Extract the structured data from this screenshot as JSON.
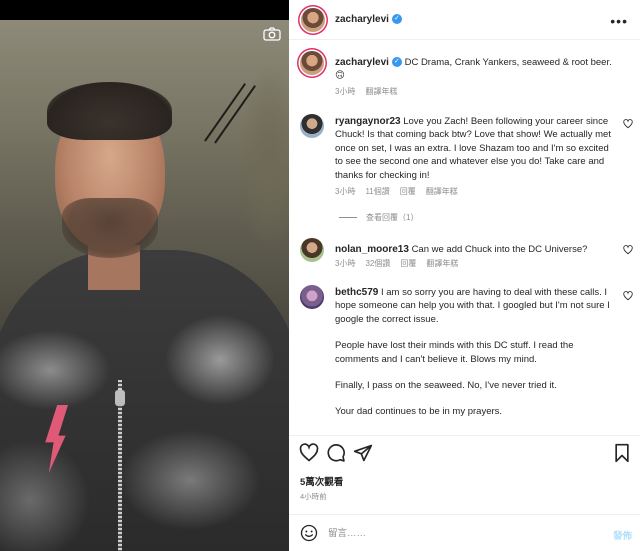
{
  "post": {
    "username": "zacharylevi",
    "caption": "DC Drama, Crank Yankers, seaweed & root beer. 🙃",
    "caption_time": "3小時",
    "caption_translate": "翻譯年糕"
  },
  "comments": [
    {
      "username": "ryangaynor23",
      "text": "Love you Zach! Been following your career since Chuck! Is that coming back btw? Love that show! We actually met once on set, I was an extra. I love Shazam too and I'm so excited to see the second one and whatever else you do! Take care and thanks for checking in!",
      "time": "3小時",
      "likes": "11個讚",
      "reply": "回覆",
      "translate": "翻譯年糕",
      "view_replies": "查看回覆（1）"
    },
    {
      "username": "nolan_moore13",
      "text": "Can we add Chuck into the DC Universe?",
      "time": "3小時",
      "likes": "32個讚",
      "reply": "回覆",
      "translate": "翻譯年糕"
    },
    {
      "username": "bethc579",
      "paragraphs": [
        "I am so sorry you are having to deal with these calls. I hope someone can help you with that. I googled but I'm not sure I google the correct issue.",
        "People have lost their minds with this DC stuff. I read the comments and I can't believe it. Blows my mind.",
        "Finally, I pass on the seaweed. No, I've never tried it.",
        "Your dad continues to be in my prayers."
      ]
    }
  ],
  "stats": {
    "views": "5萬次觀看",
    "posted": "4小時前"
  },
  "composer": {
    "placeholder": "留言……",
    "post_label": "發佈"
  },
  "colors": {
    "accent": "#3897f0",
    "verified": "#3897f0",
    "post_disabled": "#b2dffc"
  },
  "icons": [
    "camera-icon",
    "verified-icon",
    "more-icon",
    "heart-icon",
    "comment-icon",
    "share-icon",
    "bookmark-icon",
    "emoji-icon"
  ]
}
